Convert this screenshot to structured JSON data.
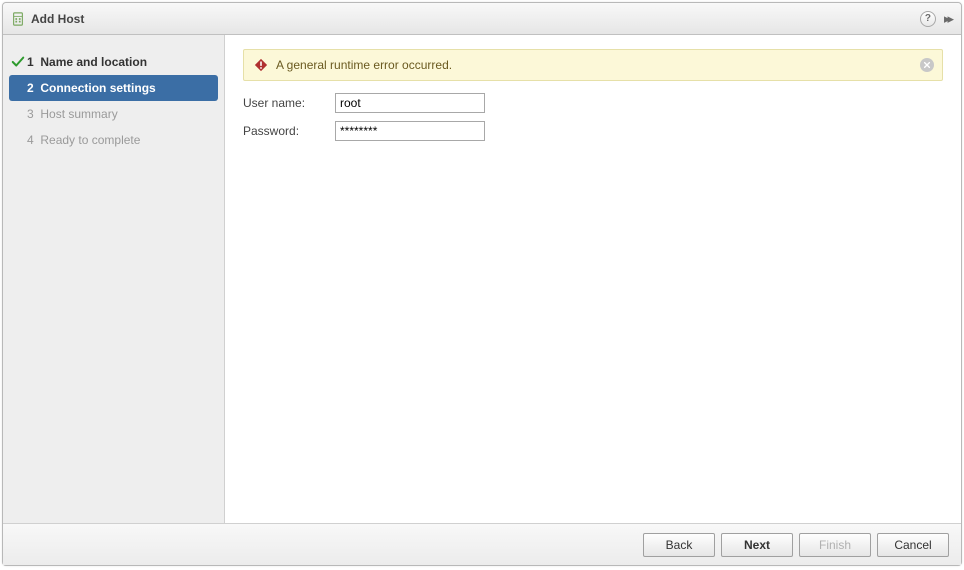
{
  "dialog": {
    "title": "Add Host"
  },
  "steps": [
    {
      "num": "1",
      "label": "Name and location",
      "state": "completed"
    },
    {
      "num": "2",
      "label": "Connection settings",
      "state": "current"
    },
    {
      "num": "3",
      "label": "Host summary",
      "state": "pending"
    },
    {
      "num": "4",
      "label": "Ready to complete",
      "state": "pending"
    }
  ],
  "alert": {
    "message": "A general runtime error occurred."
  },
  "form": {
    "username_label": "User name:",
    "username_value": "root",
    "password_label": "Password:",
    "password_value": "********"
  },
  "buttons": {
    "back": "Back",
    "next": "Next",
    "finish": "Finish",
    "cancel": "Cancel"
  }
}
